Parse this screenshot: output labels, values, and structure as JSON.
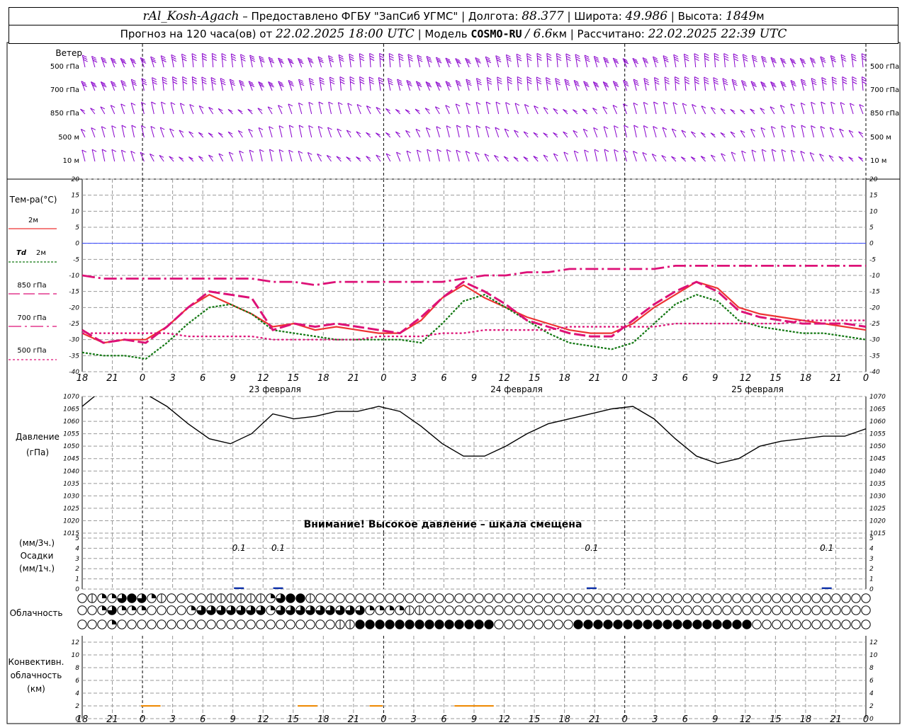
{
  "header": {
    "station": "rAl_Kosh-Agach",
    "dash": "–",
    "provider": "Предоставлено ФГБУ \"ЗапСиб УГМС\"",
    "lon_label": "Долгота:",
    "lon": "88.377",
    "lat_label": "Широта:",
    "lat": "49.986",
    "alt_label": "Высота:",
    "alt": "1849",
    "alt_unit": "м",
    "forecast_label": "Прогноз на 120 часа(ов) от",
    "forecast_time": "22.02.2025 18:00 UTC",
    "model_label": "Модель",
    "model": "COSMO-RU",
    "model_res": "/ 6.6",
    "model_res_unit": "км",
    "calc_label": "Рассчитано:",
    "calc_time": "22.02.2025 22:39 UTC"
  },
  "labels": {
    "wind": "Ветер",
    "levels": [
      "500 гПа",
      "700 гПа",
      "850 гПа",
      "500 м",
      "10 м"
    ],
    "temp": "Тем-ра(°С)",
    "t2m": "2м",
    "td": "Td",
    "td2m": "2м",
    "l850": "850 гПа",
    "l700": "700 гПа",
    "l500": "500 гПа",
    "pressure1": "Давление",
    "pressure2": "(гПа)",
    "precip1": "(мм/3ч.)",
    "precip2": "Осадки",
    "precip3": "(мм/1ч.)",
    "cloud": "Облачность",
    "conv1": "Конвективн.",
    "conv2": "облачность",
    "conv3": "(км)",
    "warning": "Внимание! Высокое давление – шкала смещена"
  },
  "colors": {
    "t2m": "#ee3333",
    "td": "#117711",
    "t850": "#dd1177",
    "t700": "#dd1177",
    "t500": "#dd1177",
    "wind": "#8800cc",
    "zero": "#3344ff",
    "pressure": "#000000",
    "precip": "#1133aa",
    "conv": "#ee8800"
  },
  "chart_data": {
    "type": "line",
    "hours": [
      18,
      21,
      0,
      3,
      6,
      9,
      12,
      15,
      18,
      21,
      0,
      3,
      6,
      9,
      12,
      15,
      18,
      21,
      0,
      3,
      6,
      9,
      12,
      15,
      18,
      21,
      0
    ],
    "day_labels": [
      "23 февраля",
      "24 февраля",
      "25 февраля"
    ],
    "temperature": {
      "ylim": [
        -40,
        20
      ],
      "ticks": [
        20,
        15,
        10,
        5,
        0,
        -5,
        -10,
        -15,
        -20,
        -25,
        -30,
        -35,
        -40
      ],
      "series": [
        {
          "key": "t2m",
          "values": [
            -28,
            -31,
            -30,
            -30,
            -26,
            -20,
            -16,
            -19,
            -22,
            -26,
            -25,
            -27,
            -26,
            -27,
            -28,
            -28,
            -24,
            -17,
            -13,
            -17,
            -20,
            -23,
            -25,
            -27,
            -28,
            -28,
            -25,
            -20,
            -16,
            -12,
            -14,
            -20,
            -22,
            -23,
            -24,
            -25,
            -26,
            -27
          ]
        },
        {
          "key": "td",
          "values": [
            -34,
            -35,
            -35,
            -36,
            -31,
            -25,
            -20,
            -19,
            -22,
            -27,
            -28,
            -29,
            -30,
            -30,
            -30,
            -30,
            -31,
            -25,
            -18,
            -16,
            -20,
            -24,
            -28,
            -31,
            -32,
            -33,
            -31,
            -25,
            -19,
            -16,
            -18,
            -24,
            -26,
            -27,
            -28,
            -28,
            -29,
            -30
          ]
        },
        {
          "key": "t850",
          "values": [
            -27,
            -31,
            -30,
            -31,
            -26,
            -20,
            -15,
            -16,
            -17,
            -27,
            -25,
            -26,
            -25,
            -26,
            -27,
            -28,
            -23,
            -17,
            -12,
            -15,
            -19,
            -24,
            -26,
            -28,
            -29,
            -29,
            -24,
            -19,
            -15,
            -12,
            -15,
            -21,
            -23,
            -24,
            -25,
            -25,
            -25,
            -26
          ]
        },
        {
          "key": "t700",
          "values": [
            -10,
            -11,
            -11,
            -11,
            -11,
            -11,
            -11,
            -11,
            -11,
            -12,
            -12,
            -13,
            -12,
            -12,
            -12,
            -12,
            -12,
            -12,
            -11,
            -10,
            -10,
            -9,
            -9,
            -8,
            -8,
            -8,
            -8,
            -8,
            -7,
            -7,
            -7,
            -7,
            -7,
            -7,
            -7,
            -7,
            -7,
            -7
          ]
        },
        {
          "key": "t500",
          "values": [
            -28,
            -28,
            -28,
            -28,
            -28,
            -29,
            -29,
            -29,
            -29,
            -30,
            -30,
            -30,
            -30,
            -30,
            -29,
            -29,
            -29,
            -28,
            -28,
            -27,
            -27,
            -27,
            -27,
            -26,
            -26,
            -26,
            -26,
            -26,
            -25,
            -25,
            -25,
            -25,
            -25,
            -25,
            -24,
            -24,
            -24,
            -24
          ]
        }
      ]
    },
    "pressure": {
      "ylim": [
        1015,
        1070
      ],
      "ticks": [
        1070,
        1065,
        1060,
        1055,
        1050,
        1045,
        1040,
        1035,
        1030,
        1025,
        1020,
        1015
      ],
      "values": [
        1066,
        1073,
        1074,
        1071,
        1066,
        1059,
        1053,
        1051,
        1055,
        1063,
        1061,
        1062,
        1064,
        1064,
        1066,
        1064,
        1058,
        1051,
        1046,
        1046,
        1050,
        1055,
        1059,
        1061,
        1063,
        1065,
        1066,
        1061,
        1053,
        1046,
        1043,
        1045,
        1050,
        1052,
        1053,
        1054,
        1054,
        1057
      ]
    },
    "precip": {
      "ylim": [
        0,
        5
      ],
      "ticks": [
        5,
        4,
        3,
        2,
        1,
        0
      ],
      "values": [
        {
          "x_hour": 24,
          "value": 0.1,
          "label": "0.1"
        },
        {
          "x_hour": 30,
          "value": 0.1,
          "label": "0.1"
        },
        {
          "x_hour": 78,
          "value": 0.1,
          "label": "0.1"
        },
        {
          "x_hour": 114,
          "value": 0.1,
          "label": "0.1"
        }
      ]
    },
    "convective": {
      "ylim": [
        0,
        13
      ],
      "ticks": [
        12,
        10,
        8,
        6,
        4,
        2,
        0
      ],
      "segments": [
        {
          "from_hour": 9,
          "to_hour": 12,
          "value": 2
        },
        {
          "from_hour": 33,
          "to_hour": 36,
          "value": 2
        },
        {
          "from_hour": 44,
          "to_hour": 46,
          "value": 2
        },
        {
          "from_hour": 57,
          "to_hour": 63,
          "value": 2
        }
      ]
    },
    "clouds": {
      "rows": [
        "01223432100001111112344100000000000000000000000000000000000000000000000000000000",
        "00232220000233333332333333333222211000000000000000000000000000000000000000000000",
        "00020000000000000000000000114444444444444400000000444444444444444444000000000000"
      ]
    }
  }
}
